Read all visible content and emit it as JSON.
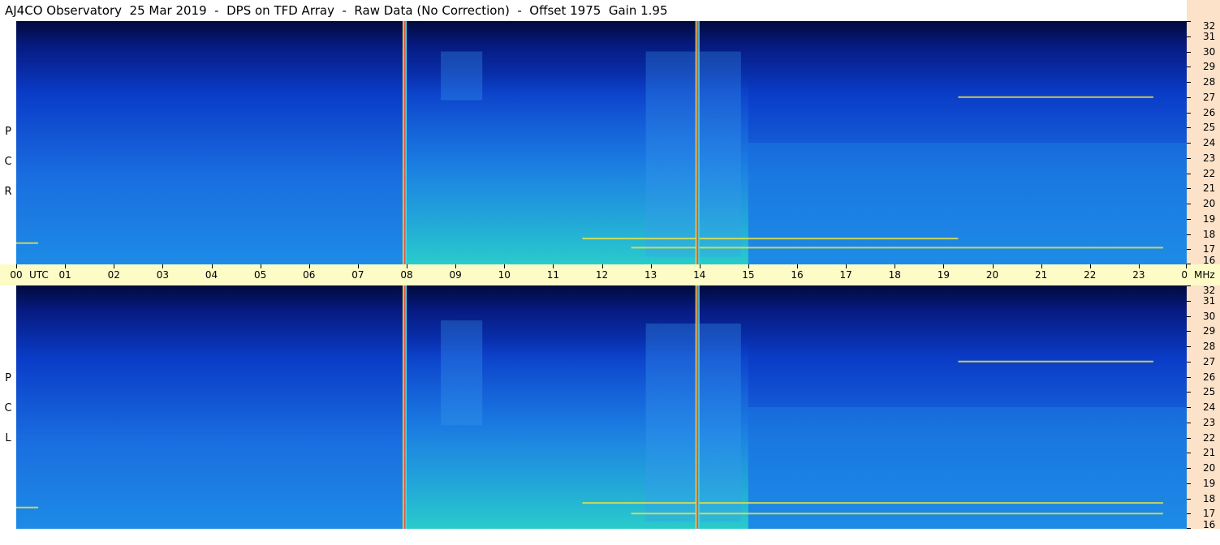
{
  "header": {
    "title": "AJ4CO Observatory  25 Mar 2019  -  DPS on TFD Array  -  Raw Data (No Correction)  -  Offset 1975  Gain 1.95"
  },
  "panels": [
    {
      "id": "rcp",
      "letters": [
        "R",
        "C",
        "P"
      ]
    },
    {
      "id": "lcp",
      "letters": [
        "L",
        "C",
        "P"
      ]
    }
  ],
  "axis": {
    "time_unit": "UTC",
    "freq_unit": "MHz"
  },
  "colors": {
    "background_dark": "#020a3c",
    "band_low": "#0a3cc8",
    "band_mid": "#1d8be6",
    "band_high": "#2ad3c8",
    "interference_line": "#e05a4a",
    "freq_axis_bg": "#fbe2c9",
    "time_axis_bg": "#fdfbc6"
  },
  "chart_data": [
    {
      "type": "heatmap",
      "panel": "rcp",
      "x": [
        "00",
        "01",
        "02",
        "03",
        "04",
        "05",
        "06",
        "07",
        "08",
        "09",
        "10",
        "11",
        "12",
        "13",
        "14",
        "15",
        "16",
        "17",
        "18",
        "19",
        "20",
        "21",
        "22",
        "23",
        "00"
      ],
      "y": [
        16,
        17,
        18,
        19,
        20,
        21,
        22,
        23,
        24,
        25,
        26,
        27,
        28,
        29,
        30,
        31,
        32
      ],
      "xlim": [
        0,
        24
      ],
      "ylim": [
        16,
        32
      ],
      "xlabel": "UTC",
      "ylabel": "MHz",
      "vertical_lines": [
        7.95,
        13.95
      ],
      "bright_blocks": [
        {
          "x_range": [
            8.7,
            9.55
          ],
          "y_range": [
            26.8,
            30.0
          ],
          "level": 0.55
        },
        {
          "x_range": [
            12.9,
            14.85
          ],
          "y_range": [
            16.5,
            30.0
          ],
          "level": 0.5
        }
      ],
      "emission_lines": [
        {
          "x_range": [
            11.6,
            19.3
          ],
          "y": 17.7
        },
        {
          "x_range": [
            12.6,
            23.5
          ],
          "y": 17.1
        },
        {
          "x_range": [
            19.3,
            23.3
          ],
          "y": 27.0
        },
        {
          "x_range": [
            0.0,
            0.45
          ],
          "y": 17.4
        }
      ]
    },
    {
      "type": "heatmap",
      "panel": "lcp",
      "x": [
        "00",
        "01",
        "02",
        "03",
        "04",
        "05",
        "06",
        "07",
        "08",
        "09",
        "10",
        "11",
        "12",
        "13",
        "14",
        "15",
        "16",
        "17",
        "18",
        "19",
        "20",
        "21",
        "22",
        "23",
        "00"
      ],
      "y": [
        16,
        17,
        18,
        19,
        20,
        21,
        22,
        23,
        24,
        25,
        26,
        27,
        28,
        29,
        30,
        31,
        32
      ],
      "xlim": [
        0,
        24
      ],
      "ylim": [
        16,
        32
      ],
      "xlabel": "UTC",
      "ylabel": "MHz",
      "vertical_lines": [
        7.95,
        13.95
      ],
      "bright_blocks": [
        {
          "x_range": [
            8.7,
            9.55
          ],
          "y_range": [
            22.8,
            29.7
          ],
          "level": 0.55
        },
        {
          "x_range": [
            12.9,
            14.85
          ],
          "y_range": [
            16.5,
            29.5
          ],
          "level": 0.55
        }
      ],
      "emission_lines": [
        {
          "x_range": [
            11.6,
            23.5
          ],
          "y": 17.7
        },
        {
          "x_range": [
            12.6,
            23.5
          ],
          "y": 17.0
        },
        {
          "x_range": [
            19.3,
            23.3
          ],
          "y": 27.0
        },
        {
          "x_range": [
            0.0,
            0.45
          ],
          "y": 17.4
        }
      ]
    }
  ]
}
